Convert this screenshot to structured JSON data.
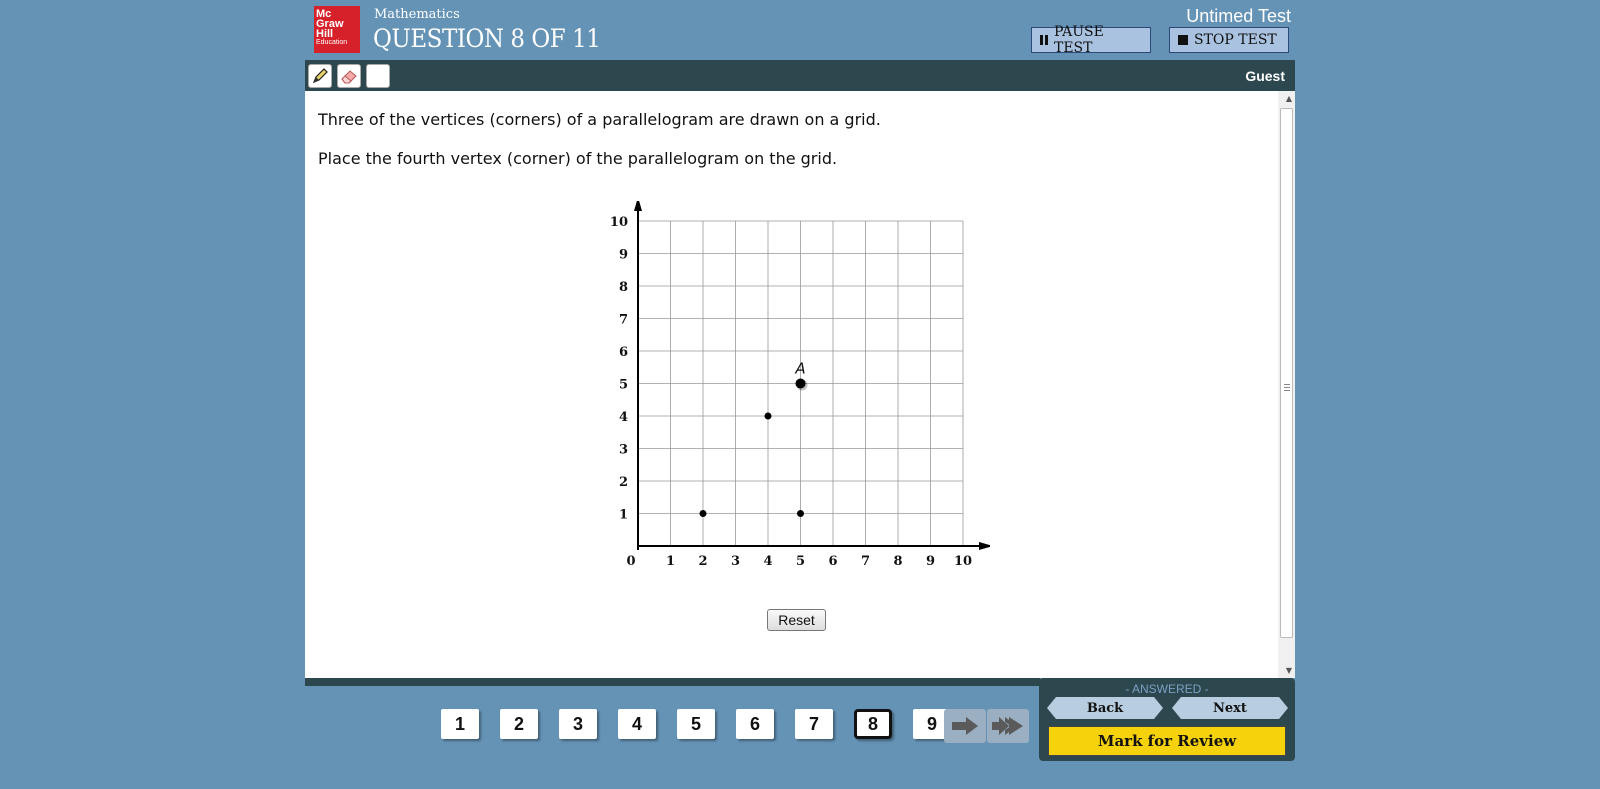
{
  "header": {
    "logo": {
      "line1": "Mc",
      "line2": "Graw",
      "line3": "Hill",
      "line4": "Education"
    },
    "subject": "Mathematics",
    "question_title": "QUESTION 8 OF 11",
    "timer_text": "Untimed Test",
    "pause_label": "PAUSE TEST",
    "stop_label": "STOP TEST"
  },
  "toolbar": {
    "tools": [
      "pencil-icon",
      "eraser-icon",
      "blank-tool"
    ],
    "user": "Guest"
  },
  "question": {
    "prompt_1": "Three of the vertices (corners) of a parallelogram are drawn on a grid.",
    "prompt_2": "Place the fourth vertex (corner) of the parallelogram on the grid.",
    "reset_label": "Reset"
  },
  "chart_data": {
    "type": "scatter",
    "x_ticks": [
      "0",
      "1",
      "2",
      "3",
      "4",
      "5",
      "6",
      "7",
      "8",
      "9",
      "10"
    ],
    "y_ticks": [
      "1",
      "2",
      "3",
      "4",
      "5",
      "6",
      "7",
      "8",
      "9",
      "10"
    ],
    "xlim": [
      0,
      10
    ],
    "ylim": [
      0,
      10
    ],
    "grid": true,
    "points": [
      {
        "x": 2,
        "y": 1,
        "label": ""
      },
      {
        "x": 5,
        "y": 1,
        "label": ""
      },
      {
        "x": 4,
        "y": 4,
        "label": ""
      },
      {
        "x": 5,
        "y": 5,
        "label": "A",
        "placed": true
      }
    ]
  },
  "footer": {
    "questions": [
      "1",
      "2",
      "3",
      "4",
      "5",
      "6",
      "7",
      "8",
      "9"
    ],
    "current": "8",
    "status": "- ANSWERED -",
    "back_label": "Back",
    "next_label": "Next",
    "mark_label": "Mark for Review"
  },
  "colors": {
    "background": "#6593b6",
    "dark_bar": "#2d474f",
    "mark_button": "#f5d20b",
    "logo_red": "#d6202a"
  }
}
